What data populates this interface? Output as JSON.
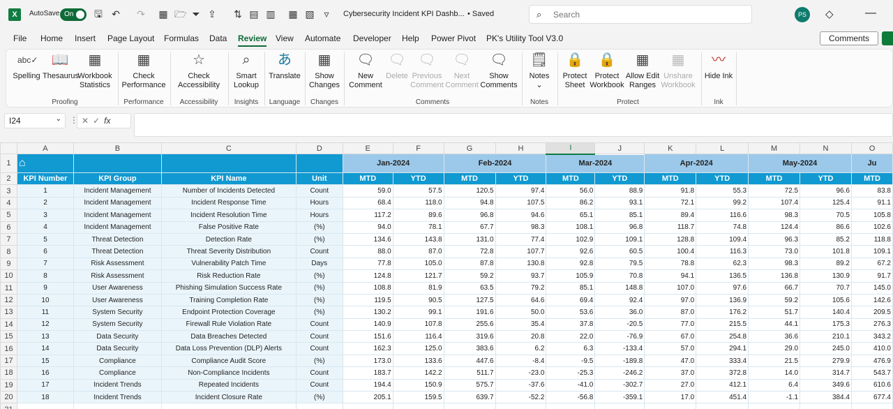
{
  "app": {
    "logo": "X",
    "autosave_label": "AutoSave",
    "autosave_state": "On",
    "doc_title": "Cybersecurity Incident KPI Dashb...",
    "saved_status": "• Saved",
    "search_placeholder": "Search",
    "user_initials": "PS"
  },
  "menu": [
    "File",
    "Home",
    "Insert",
    "Page Layout",
    "Formulas",
    "Data",
    "Review",
    "View",
    "Automate",
    "Developer",
    "Help",
    "Power Pivot",
    "PK's Utility Tool V3.0"
  ],
  "menu_active": "Review",
  "comments_button": "Comments",
  "ribbon": {
    "buttons": [
      {
        "label": "Spelling",
        "icon": "spelling-icon"
      },
      {
        "label": "Thesaurus",
        "icon": "thesaurus-icon"
      },
      {
        "label": "Workbook Statistics",
        "icon": "workbook-statistics-icon"
      },
      {
        "label": "Check Performance",
        "icon": "check-performance-icon"
      },
      {
        "label": "Check Accessibility",
        "icon": "accessibility-icon"
      },
      {
        "label": "Smart Lookup",
        "icon": "smart-lookup-icon"
      },
      {
        "label": "Translate",
        "icon": "translate-icon"
      },
      {
        "label": "Show Changes",
        "icon": "show-changes-icon"
      },
      {
        "label": "New Comment",
        "icon": "new-comment-icon"
      },
      {
        "label": "Delete",
        "icon": "delete-comment-icon"
      },
      {
        "label": "Previous Comment",
        "icon": "previous-comment-icon"
      },
      {
        "label": "Next Comment",
        "icon": "next-comment-icon"
      },
      {
        "label": "Show Comments",
        "icon": "show-comments-icon"
      },
      {
        "label": "Notes",
        "icon": "notes-icon"
      },
      {
        "label": "Protect Sheet",
        "icon": "protect-sheet-icon"
      },
      {
        "label": "Protect Workbook",
        "icon": "protect-workbook-icon"
      },
      {
        "label": "Allow Edit Ranges",
        "icon": "allow-edit-ranges-icon"
      },
      {
        "label": "Unshare Workbook",
        "icon": "unshare-workbook-icon"
      },
      {
        "label": "Hide Ink",
        "icon": "hide-ink-icon"
      }
    ],
    "groups": [
      "Proofing",
      "Performance",
      "Accessibility",
      "Insights",
      "Language",
      "Changes",
      "Comments",
      "Notes",
      "Protect",
      "Ink"
    ]
  },
  "formula_bar": {
    "name_box": "I24",
    "fx": "fx",
    "formula": ""
  },
  "sheet": {
    "columns": [
      "A",
      "B",
      "C",
      "D",
      "E",
      "F",
      "G",
      "H",
      "I",
      "J",
      "K",
      "L",
      "M",
      "N",
      "O"
    ],
    "selected_column": "I",
    "months": [
      "Jan-2024",
      "Feb-2024",
      "Mar-2024",
      "Apr-2024",
      "May-2024",
      "Ju"
    ],
    "headers": [
      "KPI Number",
      "KPI Group",
      "KPI Name",
      "Unit",
      "MTD",
      "YTD",
      "MTD",
      "YTD",
      "MTD",
      "YTD",
      "MTD",
      "YTD",
      "MTD",
      "YTD",
      "MTD"
    ],
    "rows": [
      [
        "1",
        "Incident Management",
        "Number of Incidents Detected",
        "Count",
        "59.0",
        "57.5",
        "120.5",
        "97.4",
        "56.0",
        "88.9",
        "91.8",
        "55.3",
        "72.5",
        "96.6",
        "83.8"
      ],
      [
        "2",
        "Incident Management",
        "Incident Response Time",
        "Hours",
        "68.4",
        "118.0",
        "94.8",
        "107.5",
        "86.2",
        "93.1",
        "72.1",
        "99.2",
        "107.4",
        "125.4",
        "91.1"
      ],
      [
        "3",
        "Incident Management",
        "Incident Resolution Time",
        "Hours",
        "117.2",
        "89.6",
        "96.8",
        "94.6",
        "65.1",
        "85.1",
        "89.4",
        "116.6",
        "98.3",
        "70.5",
        "105.8"
      ],
      [
        "4",
        "Incident Management",
        "False Positive Rate",
        "(%)",
        "94.0",
        "78.1",
        "67.7",
        "98.3",
        "108.1",
        "96.8",
        "118.7",
        "74.8",
        "124.4",
        "86.6",
        "102.6"
      ],
      [
        "5",
        "Threat Detection",
        "Detection Rate",
        "(%)",
        "134.6",
        "143.8",
        "131.0",
        "77.4",
        "102.9",
        "109.1",
        "128.8",
        "109.4",
        "96.3",
        "85.2",
        "118.8"
      ],
      [
        "6",
        "Threat Detection",
        "Threat Severity Distribution",
        "Count",
        "88.0",
        "87.0",
        "72.8",
        "107.7",
        "92.6",
        "60.5",
        "100.4",
        "116.3",
        "73.0",
        "101.8",
        "109.1"
      ],
      [
        "7",
        "Risk Assessment",
        "Vulnerability Patch Time",
        "Days",
        "77.8",
        "105.0",
        "87.8",
        "130.8",
        "92.8",
        "79.5",
        "78.8",
        "62.3",
        "98.3",
        "89.2",
        "67.2"
      ],
      [
        "8",
        "Risk Assessment",
        "Risk Reduction Rate",
        "(%)",
        "124.8",
        "121.7",
        "59.2",
        "93.7",
        "105.9",
        "70.8",
        "94.1",
        "136.5",
        "136.8",
        "130.9",
        "91.7"
      ],
      [
        "9",
        "User Awareness",
        "Phishing Simulation Success Rate",
        "(%)",
        "108.8",
        "81.9",
        "63.5",
        "79.2",
        "85.1",
        "148.8",
        "107.0",
        "97.6",
        "66.7",
        "70.7",
        "145.0"
      ],
      [
        "10",
        "User Awareness",
        "Training Completion Rate",
        "(%)",
        "119.5",
        "90.5",
        "127.5",
        "64.6",
        "69.4",
        "92.4",
        "97.0",
        "136.9",
        "59.2",
        "105.6",
        "142.6"
      ],
      [
        "11",
        "System Security",
        "Endpoint Protection Coverage",
        "(%)",
        "130.2",
        "99.1",
        "191.6",
        "50.0",
        "53.6",
        "36.0",
        "87.0",
        "176.2",
        "51.7",
        "140.4",
        "209.5"
      ],
      [
        "12",
        "System Security",
        "Firewall Rule Violation Rate",
        "Count",
        "140.9",
        "107.8",
        "255.6",
        "35.4",
        "37.8",
        "-20.5",
        "77.0",
        "215.5",
        "44.1",
        "175.3",
        "276.3"
      ],
      [
        "13",
        "Data Security",
        "Data Breaches Detected",
        "Count",
        "151.6",
        "116.4",
        "319.6",
        "20.8",
        "22.0",
        "-76.9",
        "67.0",
        "254.8",
        "36.6",
        "210.1",
        "343.2"
      ],
      [
        "14",
        "Data Security",
        "Data Loss Prevention (DLP) Alerts",
        "Count",
        "162.3",
        "125.0",
        "383.6",
        "6.2",
        "6.3",
        "-133.4",
        "57.0",
        "294.1",
        "29.0",
        "245.0",
        "410.0"
      ],
      [
        "15",
        "Compliance",
        "Compliance Audit Score",
        "(%)",
        "173.0",
        "133.6",
        "447.6",
        "-8.4",
        "-9.5",
        "-189.8",
        "47.0",
        "333.4",
        "21.5",
        "279.9",
        "476.9"
      ],
      [
        "16",
        "Compliance",
        "Non-Compliance Incidents",
        "Count",
        "183.7",
        "142.2",
        "511.7",
        "-23.0",
        "-25.3",
        "-246.2",
        "37.0",
        "372.8",
        "14.0",
        "314.7",
        "543.7"
      ],
      [
        "17",
        "Incident Trends",
        "Repeated Incidents",
        "Count",
        "194.4",
        "150.9",
        "575.7",
        "-37.6",
        "-41.0",
        "-302.7",
        "27.0",
        "412.1",
        "6.4",
        "349.6",
        "610.6"
      ],
      [
        "18",
        "Incident Trends",
        "Incident Closure Rate",
        "(%)",
        "205.1",
        "159.5",
        "639.7",
        "-52.2",
        "-56.8",
        "-359.1",
        "17.0",
        "451.4",
        "-1.1",
        "384.4",
        "677.4"
      ]
    ],
    "row_numbers": [
      "1",
      "2",
      "3",
      "4",
      "5",
      "6",
      "7",
      "8",
      "9",
      "10",
      "11",
      "12",
      "13",
      "14",
      "15",
      "16",
      "17",
      "18",
      "19",
      "20",
      "21"
    ]
  }
}
